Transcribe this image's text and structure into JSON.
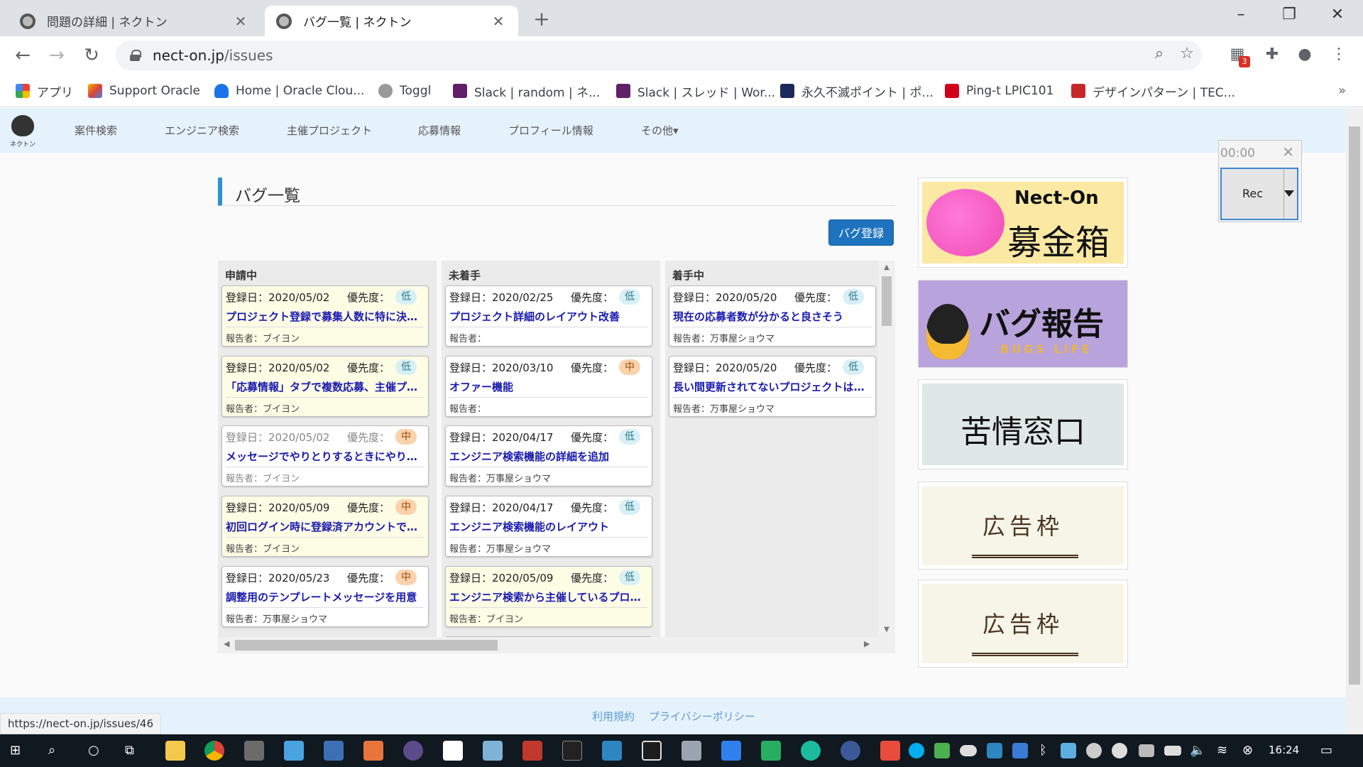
{
  "browser": {
    "tabs": [
      {
        "title": "問題の詳細 | ネクトン"
      },
      {
        "title": "バグ一覧 | ネクトン"
      }
    ],
    "new_tab_glyph": "+",
    "url_host": "nect-on.jp",
    "url_path": "/issues",
    "status_url": "https://nect-on.jp/issues/46",
    "extension_badge": "3"
  },
  "bookmarks": [
    {
      "label": "アプリ",
      "color": "#e94235"
    },
    {
      "label": "Support Oracle",
      "color": "#cccccc"
    },
    {
      "label": "Home | Oracle Clou...",
      "color": "#1a73e8"
    },
    {
      "label": "Toggl",
      "color": "#999999"
    },
    {
      "label": "Slack | random | ネ...",
      "color": "#611f69"
    },
    {
      "label": "Slack | スレッド | Wor...",
      "color": "#611f69"
    },
    {
      "label": "永久不滅ポイント | ポ...",
      "color": "#1b2a5b"
    },
    {
      "label": "Ping-t LPIC101",
      "color": "#d0021b"
    },
    {
      "label": "デザインパターン | TEC...",
      "color": "#c62828"
    }
  ],
  "site": {
    "logo_label": "ネクトン",
    "nav": [
      "案件検索",
      "エンジニア検索",
      "主催プロジェクト",
      "応募情報",
      "プロフィール情報",
      "その他▾"
    ],
    "page_title": "バグ一覧",
    "register_button": "バグ登録",
    "footer_links": [
      "利用規約",
      "プライバシーポリシー"
    ]
  },
  "columns": [
    {
      "name": "申請中",
      "cards": [
        {
          "date": "登録日：2020/05/02",
          "priority_label": "優先度：",
          "priority": "低",
          "level": "low",
          "title": "プロジェクト登録で募集人数に特に決まりがない場合",
          "reporter": "報告者：ブイヨン",
          "style": "hl"
        },
        {
          "date": "登録日：2020/05/02",
          "priority_label": "優先度：",
          "priority": "低",
          "level": "low",
          "title": "「応募情報」タブで複数応募、主催プロジェクト",
          "reporter": "報告者：ブイヨン",
          "style": "hl"
        },
        {
          "date": "登録日：2020/05/02",
          "priority_label": "優先度：",
          "priority": "中",
          "level": "mid",
          "title": "メッセージでやりとりするときにやりとりしやすく",
          "reporter": "報告者：ブイヨン",
          "style": "dim"
        },
        {
          "date": "登録日：2020/05/09",
          "priority_label": "優先度：",
          "priority": "中",
          "level": "mid",
          "title": "初回ログイン時に登録済アカウントで入る",
          "reporter": "報告者：ブイヨン",
          "style": "hl"
        },
        {
          "date": "登録日：2020/05/23",
          "priority_label": "優先度：",
          "priority": "中",
          "level": "mid",
          "title": "調整用のテンプレートメッセージを用意",
          "reporter": "報告者：万事屋ショウマ",
          "style": "plain"
        }
      ]
    },
    {
      "name": "未着手",
      "cards": [
        {
          "date": "登録日：2020/02/25",
          "priority_label": "優先度：",
          "priority": "低",
          "level": "low",
          "title": "プロジェクト詳細のレイアウト改善",
          "reporter": "報告者：",
          "style": "plain"
        },
        {
          "date": "登録日：2020/03/10",
          "priority_label": "優先度：",
          "priority": "中",
          "level": "mid",
          "title": "オファー機能",
          "reporter": "報告者：",
          "style": "plain"
        },
        {
          "date": "登録日：2020/04/17",
          "priority_label": "優先度：",
          "priority": "低",
          "level": "low",
          "title": "エンジニア検索機能の詳細を追加",
          "reporter": "報告者：万事屋ショウマ",
          "style": "plain"
        },
        {
          "date": "登録日：2020/04/17",
          "priority_label": "優先度：",
          "priority": "低",
          "level": "low",
          "title": "エンジニア検索機能のレイアウト",
          "reporter": "報告者：万事屋ショウマ",
          "style": "plain"
        },
        {
          "date": "登録日：2020/05/09",
          "priority_label": "優先度：",
          "priority": "低",
          "level": "low",
          "title": "エンジニア検索から主催しているプロジェクト",
          "reporter": "報告者：ブイヨン",
          "style": "hl"
        }
      ]
    },
    {
      "name": "着手中",
      "cards": [
        {
          "date": "登録日：2020/05/20",
          "priority_label": "優先度：",
          "priority": "低",
          "level": "low",
          "title": "現在の応募者数が分かると良さそう",
          "reporter": "報告者：万事屋ショウマ",
          "style": "plain"
        },
        {
          "date": "登録日：2020/05/20",
          "priority_label": "優先度：",
          "priority": "低",
          "level": "low",
          "title": "長い間更新されてないプロジェクトは表示しない",
          "reporter": "報告者：万事屋ショウマ",
          "style": "plain"
        }
      ]
    }
  ],
  "banners": {
    "donation_brand": "Nect-On",
    "donation_title": "募金箱",
    "bug_title": "バグ報告",
    "bug_sub": "BUGS LIFE",
    "complaint_title": "苦情窓口",
    "ad_title": "広告枠"
  },
  "recorder": {
    "time": "00:00",
    "button": "Rec"
  },
  "taskbar": {
    "clock": "16:24"
  }
}
